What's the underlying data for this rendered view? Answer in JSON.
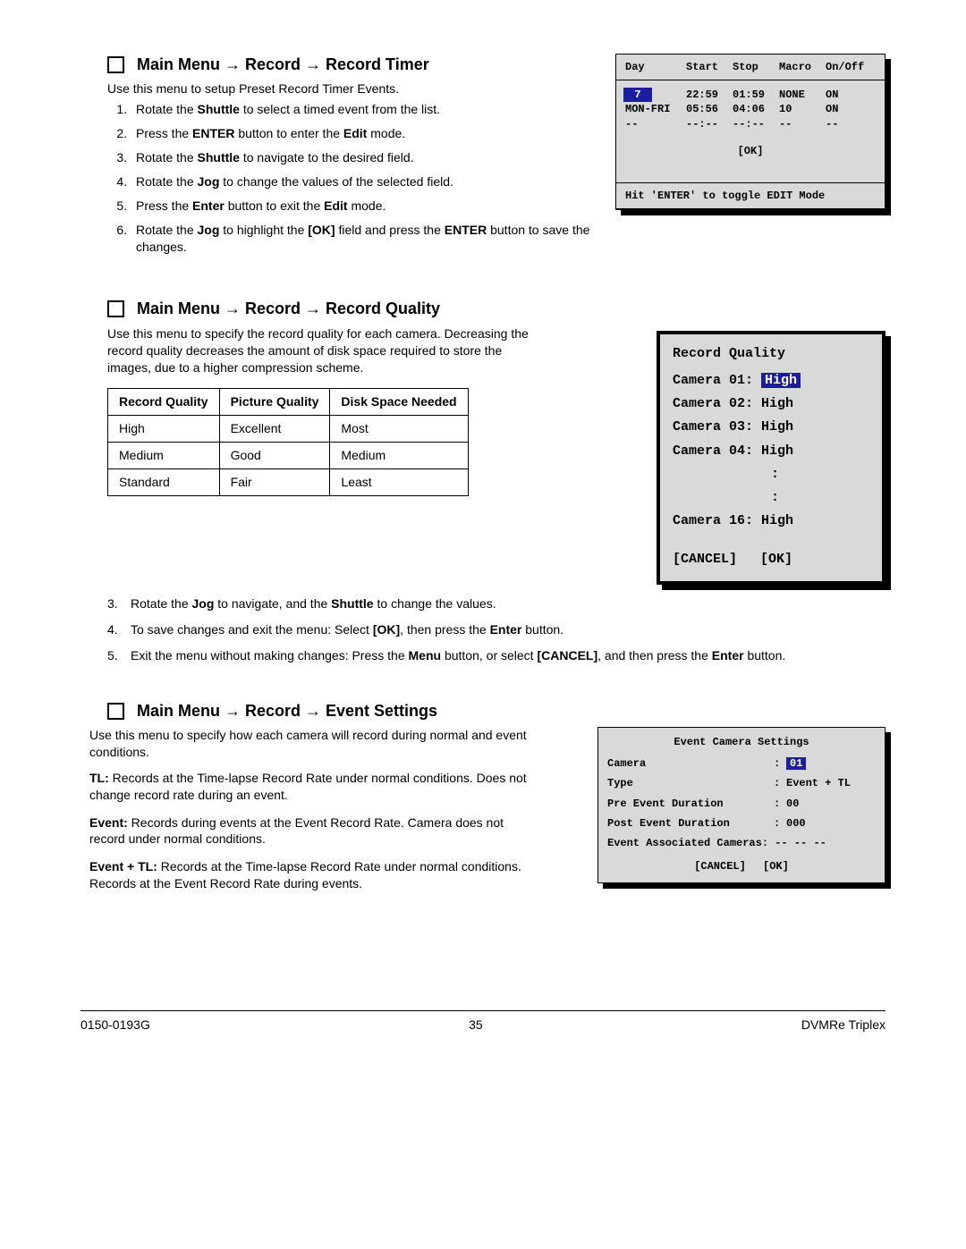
{
  "section1": {
    "heading": "Main Menu → Record → Record Timer",
    "intro": "Use this menu to setup Preset Record Timer Events.",
    "steps": [
      {
        "pre": "Rotate the ",
        "b1": "Shuttle",
        "post": " to select a timed event from the list."
      },
      {
        "pre": "Press the ",
        "b1": "ENTER",
        "mid": " button to enter the ",
        "b2": "Edit",
        "post": " mode."
      },
      {
        "pre": "Rotate the ",
        "b1": "Shuttle",
        "post": " to navigate to the desired field."
      },
      {
        "pre": "Rotate the ",
        "b1": "Jog",
        "post": " to change the values of the selected field."
      },
      {
        "pre": "Press the ",
        "b1": "Enter",
        "mid": " button to exit the ",
        "b2": "Edit",
        "post": " mode."
      },
      {
        "pre": "Rotate the ",
        "b1": "Jog",
        "mid": " to highlight the ",
        "b2": "[OK]",
        "mid2": " field and press the ",
        "b3": "ENTER",
        "post": " button to save the changes."
      }
    ]
  },
  "timer_panel": {
    "cols": {
      "day": "Day",
      "start": "Start",
      "stop": "Stop",
      "macro": "Macro",
      "onoff": "On/Off"
    },
    "rows": [
      {
        "day": "7",
        "sel": true,
        "start": "22:59",
        "stop": "01:59",
        "macro": "NONE",
        "onoff": "ON"
      },
      {
        "day": "MON-FRI",
        "sel": false,
        "start": "05:56",
        "stop": "04:06",
        "macro": "10",
        "onoff": "ON"
      },
      {
        "day": "--",
        "sel": false,
        "start": "--:--",
        "stop": "--:--",
        "macro": "--",
        "onoff": "--"
      }
    ],
    "ok": "[OK]",
    "footer": "Hit 'ENTER' to toggle EDIT Mode"
  },
  "section2": {
    "heading": "Main Menu → Record → Record Quality",
    "intro": "Use this menu to specify the record quality for each camera. Decreasing the record quality decreases the amount of disk space required to store the images, due to a higher compression scheme.",
    "table": {
      "headers": [
        "Record Quality",
        "Picture Quality",
        "Disk Space Needed"
      ],
      "rows": [
        [
          "High",
          "Excellent",
          "Most"
        ],
        [
          "Medium",
          "Good",
          "Medium"
        ],
        [
          "Standard",
          "Fair",
          "Least"
        ]
      ]
    },
    "steps": [
      {
        "n": "3.",
        "pre": "Rotate the ",
        "b1": "Jog",
        "mid": " to navigate, and the ",
        "b2": "Shuttle",
        "post": " to change the values."
      },
      {
        "n": "4.",
        "pre": "To save changes and exit the menu:  Select ",
        "b1": "[OK]",
        "mid": ", then press the ",
        "b2": "Enter",
        "post": " button."
      },
      {
        "n": "5.",
        "pre": "Exit the menu without making changes:  Press the ",
        "b1": "Menu",
        "mid": " button, or select ",
        "b2": "[CANCEL]",
        "mid2": ", and then press the ",
        "b3": "Enter",
        "post": " button."
      }
    ]
  },
  "rq_panel": {
    "title": "Record Quality",
    "lines": [
      {
        "label": "Camera 01:",
        "val": "High",
        "sel": true
      },
      {
        "label": "Camera 02:",
        "val": "High"
      },
      {
        "label": "Camera 03:",
        "val": "High"
      },
      {
        "label": "Camera 04:",
        "val": "High"
      }
    ],
    "dots": ":",
    "last": {
      "label": "Camera 16:",
      "val": "High"
    },
    "cancel": "[CANCEL]",
    "ok": "[OK]"
  },
  "section3": {
    "heading": "Main Menu → Record → Event Settings",
    "intro": "Use this menu to specify how each camera will record during normal and event conditions.",
    "paras": [
      {
        "b": "TL:",
        "t": "  Records at the Time-lapse Record Rate under normal conditions.  Does not change record rate during an event."
      },
      {
        "b": "Event:",
        "t": "  Records during events at the Event Record Rate.  Camera does not record under normal conditions."
      },
      {
        "b": "Event + TL:",
        "t": "  Records at the Time-lapse Record Rate under normal conditions.  Records at the Event Record Rate during events."
      }
    ]
  },
  "ev_panel": {
    "title": "Event Camera Settings",
    "rows": [
      {
        "label": "Camera",
        "val": "01",
        "sel": true
      },
      {
        "label": "Type",
        "val": "Event + TL"
      },
      {
        "label": "Pre Event Duration",
        "val": "00"
      },
      {
        "label": "Post Event Duration",
        "val": "000"
      }
    ],
    "assoc_label": "Event Associated Cameras:",
    "assoc_val": "-- -- --",
    "cancel": "[CANCEL]",
    "ok": "[OK]"
  },
  "footer": {
    "left": "0150-0193G",
    "center": "35",
    "right": "DVMRe Triplex"
  }
}
